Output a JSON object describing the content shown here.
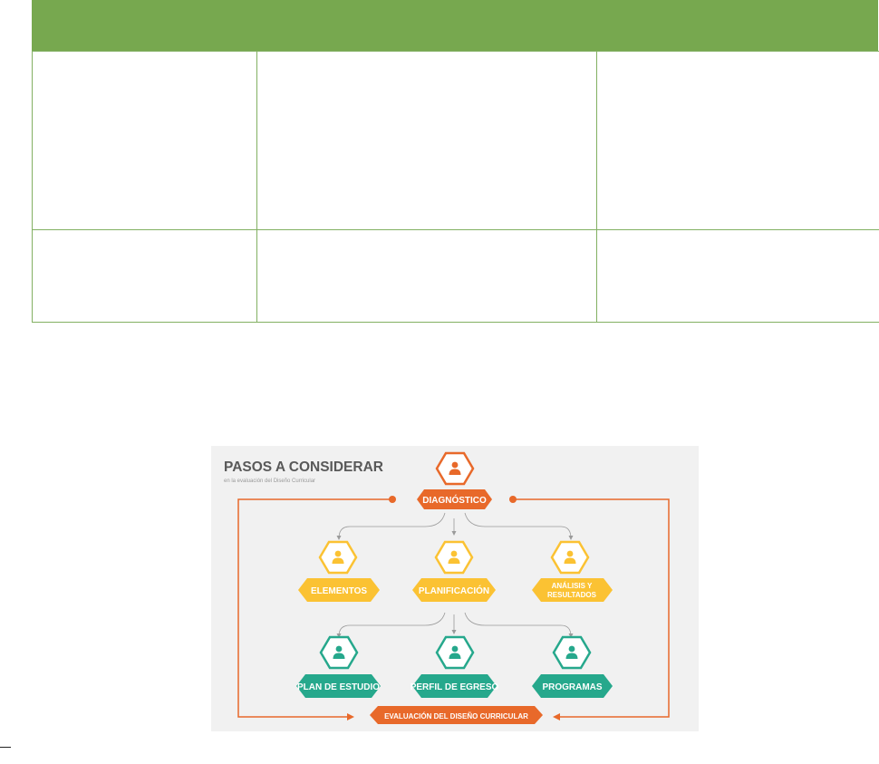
{
  "infographic": {
    "title": "PASOS A CONSIDERAR",
    "subtitle": "en la evaluación del Diseño Curricular",
    "steps": {
      "diagnostico": "DIAGNÓSTICO",
      "elementos": "ELEMENTOS",
      "planificacion": "PLANIFICACIÓN",
      "analisis_line1": "ANÁLISIS Y",
      "analisis_line2": "RESULTADOS",
      "plan_estudio": "PLAN DE ESTUDIO",
      "perfil_egreso": "PERFIL DE EGRESO",
      "programas": "PROGRAMAS",
      "evaluacion": "EVALUACIÓN DEL DISEÑO CURRICULAR"
    },
    "colors": {
      "orange": "#e8692a",
      "yellow": "#fbc233",
      "teal": "#26a88c",
      "table_header": "#77a84f"
    },
    "icons": [
      "user-icon"
    ]
  }
}
